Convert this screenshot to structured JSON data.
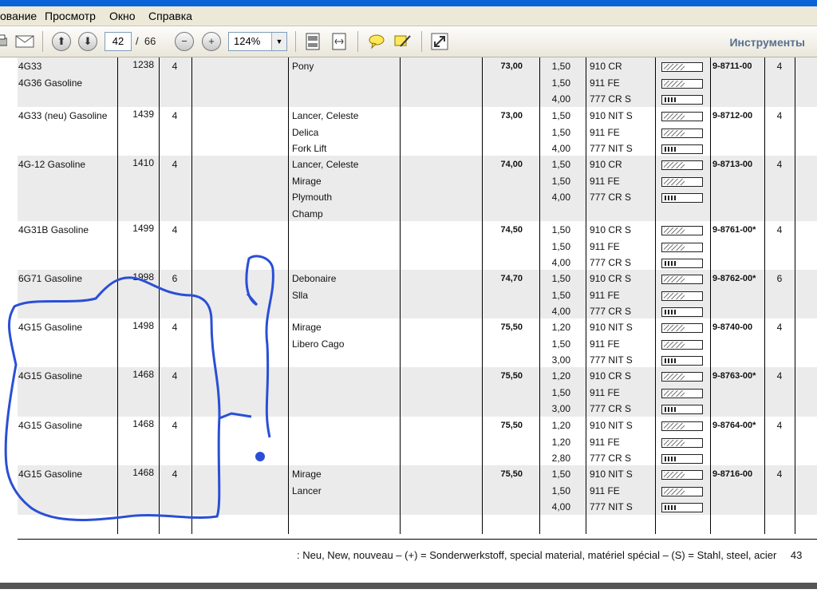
{
  "menu": [
    "ование",
    "Просмотр",
    "Окно",
    "Справка"
  ],
  "toolbar": {
    "page_current": "42",
    "page_sep": "/",
    "page_total": "66",
    "zoom": "124%",
    "tools_label": "Инструменты"
  },
  "icons": [
    "print-icon",
    "email-icon",
    "prev-page-icon",
    "next-page-icon",
    "zoom-out-icon",
    "zoom-in-icon",
    "fit-page-icon",
    "fit-width-icon",
    "comment-icon",
    "markup-icon",
    "fullscreen-icon"
  ],
  "rows": [
    {
      "engine": [
        "4G33",
        "4G36 Gasoline"
      ],
      "ccm": "1238",
      "cyl": "4",
      "model": [
        "Pony"
      ],
      "bore": "73,00",
      "rings": [
        {
          "h": "1,50",
          "code": "910 CR"
        },
        {
          "h": "1,50",
          "code": "911 FE"
        },
        {
          "h": "4,00",
          "code": "777 CR S"
        }
      ],
      "part": "9-8711-00",
      "qty": "4"
    },
    {
      "engine": [
        "4G33 (neu) Gasoline"
      ],
      "ccm": "1439",
      "cyl": "4",
      "model": [
        "Lancer, Celeste",
        "Delica",
        "Fork Lift"
      ],
      "bore": "73,00",
      "rings": [
        {
          "h": "1,50",
          "code": "910 NIT S"
        },
        {
          "h": "1,50",
          "code": "911 FE"
        },
        {
          "h": "4,00",
          "code": "777 NIT S"
        }
      ],
      "part": "9-8712-00",
      "qty": "4"
    },
    {
      "engine": [
        "4G-12 Gasoline"
      ],
      "ccm": "1410",
      "cyl": "4",
      "model": [
        "Lancer, Celeste",
        "Mirage",
        "Plymouth",
        "Champ"
      ],
      "bore": "74,00",
      "rings": [
        {
          "h": "1,50",
          "code": "910 CR"
        },
        {
          "h": "1,50",
          "code": "911 FE"
        },
        {
          "h": "4,00",
          "code": "777 CR S"
        }
      ],
      "part": "9-8713-00",
      "qty": "4"
    },
    {
      "engine": [
        "4G31B Gasoline"
      ],
      "ccm": "1499",
      "cyl": "4",
      "model": [],
      "bore": "74,50",
      "rings": [
        {
          "h": "1,50",
          "code": "910 CR S"
        },
        {
          "h": "1,50",
          "code": "911 FE"
        },
        {
          "h": "4,00",
          "code": "777 CR S"
        }
      ],
      "part": "9-8761-00*",
      "qty": "4"
    },
    {
      "engine": [
        "6G71 Gasoline"
      ],
      "ccm": "1998",
      "cyl": "6",
      "model": [
        "Debonaire",
        "Slla"
      ],
      "bore": "74,70",
      "rings": [
        {
          "h": "1,50",
          "code": "910 CR S"
        },
        {
          "h": "1,50",
          "code": "911 FE"
        },
        {
          "h": "4,00",
          "code": "777 CR S"
        }
      ],
      "part": "9-8762-00*",
      "qty": "6"
    },
    {
      "engine": [
        "4G15 Gasoline"
      ],
      "ccm": "1498",
      "cyl": "4",
      "model": [
        "Mirage",
        "Libero Cago"
      ],
      "bore": "75,50",
      "rings": [
        {
          "h": "1,20",
          "code": "910 NIT S"
        },
        {
          "h": "1,50",
          "code": "911 FE"
        },
        {
          "h": "3,00",
          "code": "777 NIT S"
        }
      ],
      "part": "9-8740-00",
      "qty": "4"
    },
    {
      "engine": [
        "4G15 Gasoline"
      ],
      "ccm": "1468",
      "cyl": "4",
      "model": [],
      "bore": "75,50",
      "rings": [
        {
          "h": "1,20",
          "code": "910 CR S"
        },
        {
          "h": "1,50",
          "code": "911 FE"
        },
        {
          "h": "3,00",
          "code": "777 CR S"
        }
      ],
      "part": "9-8763-00*",
      "qty": "4"
    },
    {
      "engine": [
        "4G15 Gasoline"
      ],
      "ccm": "1468",
      "cyl": "4",
      "model": [],
      "bore": "75,50",
      "rings": [
        {
          "h": "1,20",
          "code": "910 NIT S"
        },
        {
          "h": "1,20",
          "code": "911 FE"
        },
        {
          "h": "2,80",
          "code": "777 CR S"
        }
      ],
      "part": "9-8764-00*",
      "qty": "4"
    },
    {
      "engine": [
        "4G15 Gasoline"
      ],
      "ccm": "1468",
      "cyl": "4",
      "model": [
        "Mirage",
        "Lancer"
      ],
      "bore": "75,50",
      "rings": [
        {
          "h": "1,50",
          "code": "910 NIT S"
        },
        {
          "h": "1,50",
          "code": "911 FE"
        },
        {
          "h": "4,00",
          "code": "777 NIT S"
        }
      ],
      "part": "9-8716-00",
      "qty": "4"
    }
  ],
  "footnote": ": Neu, New, nouveau – (+) = Sonderwerkstoff, special material, matériel spécial – (S) = Stahl, steel, acier",
  "page_number_fragment": "43",
  "colors": {
    "titlebar": "#0a64d8",
    "band": "#ebebeb",
    "scribble": "#2a4fd6",
    "tools": "#5a6f8f"
  }
}
